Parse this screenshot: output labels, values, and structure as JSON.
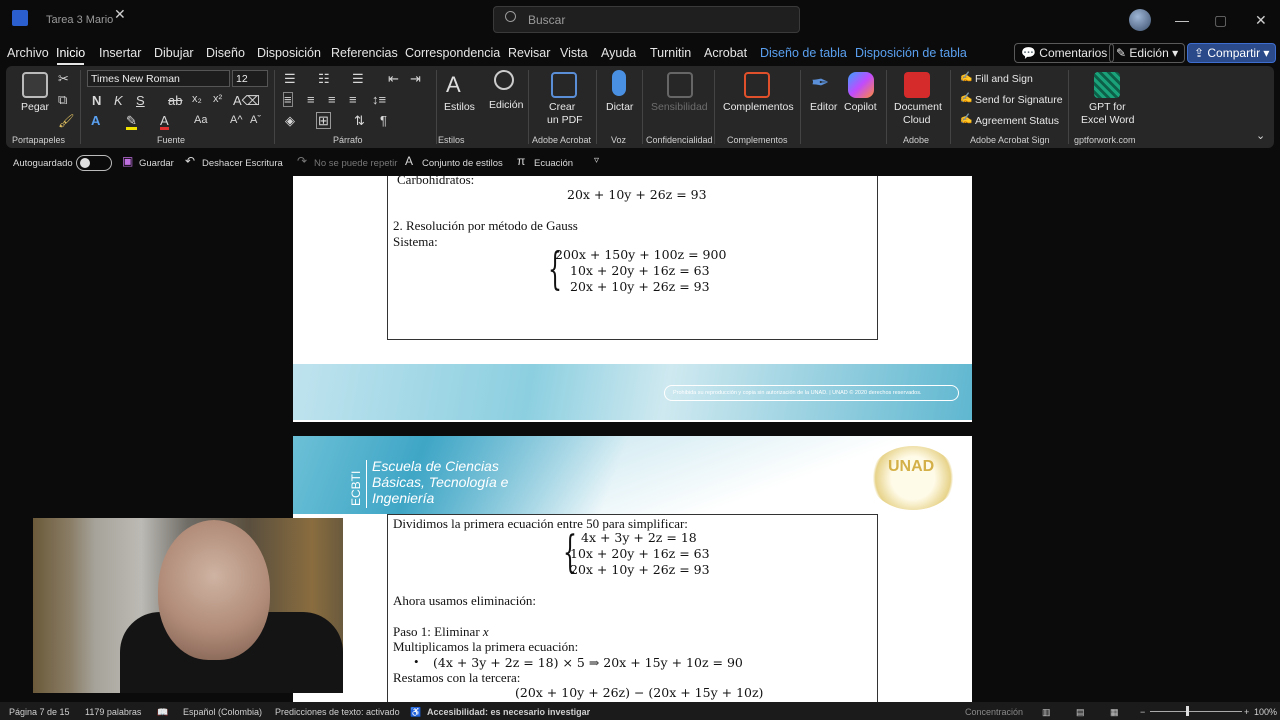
{
  "window": {
    "doc_title": "Tarea 3 Mario",
    "search_placeholder": "Buscar",
    "controls": {
      "minimize": "—",
      "maximize": "▢",
      "close": "✕"
    }
  },
  "menu": {
    "items": [
      "Archivo",
      "Inicio",
      "Insertar",
      "Dibujar",
      "Diseño",
      "Disposición",
      "Referencias",
      "Correspondencia",
      "Revisar",
      "Vista",
      "Ayuda",
      "Turnitin",
      "Acrobat"
    ],
    "contextual": [
      "Diseño de tabla",
      "Disposición de tabla"
    ],
    "comments": "Comentarios",
    "editing": "Edición",
    "share": "Compartir"
  },
  "ribbon": {
    "clipboard": {
      "paste": "Pegar",
      "label": "Portapapeles"
    },
    "font": {
      "name": "Times New Roman",
      "size": "12",
      "label": "Fuente",
      "bold": "N",
      "italic": "K",
      "underline": "S"
    },
    "paragraph": {
      "label": "Párrafo"
    },
    "styles": {
      "button": "Estilos",
      "label": "Estilos"
    },
    "editing": {
      "button": "Edición"
    },
    "acrobat": {
      "create_pdf_line1": "Crear",
      "create_pdf_line2": "un PDF",
      "label": "Adobe Acrobat"
    },
    "voice": {
      "dictate": "Dictar",
      "label": "Voz"
    },
    "sensitivity": {
      "button": "Sensibilidad",
      "label": "Confidencialidad"
    },
    "addins": {
      "button": "Complementos",
      "label": "Complementos"
    },
    "editor": "Editor",
    "copilot": "Copilot",
    "adobe": {
      "doc_cloud_line1": "Document",
      "doc_cloud_line2": "Cloud",
      "label": "Adobe"
    },
    "sign": {
      "fill": "Fill and Sign",
      "send": "Send for Signature",
      "status": "Agreement Status",
      "label": "Adobe Acrobat Sign"
    },
    "gpt": {
      "line1": "GPT for",
      "line2": "Excel Word",
      "label": "gptforwork.com"
    }
  },
  "qat": {
    "autosave": "Autoguardado",
    "save": "Guardar",
    "undo": "Deshacer Escritura",
    "redo": "No se puede repetir",
    "styles_set": "Conjunto de estilos",
    "equation": "Ecuación"
  },
  "page1": {
    "cut_line": "Carbohidratos:",
    "eq_carb": "20x + 10y + 26z = 93",
    "heading": "2. Resolución por método de Gauss",
    "system_label": "Sistema:",
    "system": [
      "200x + 150y + 100z = 900",
      "10x + 20y + 16z = 63",
      "20x + 10y + 26z = 93"
    ],
    "footer_note": "Prohibida su reproducción y copia sin autorización de la UNAD.  |  UNAD © 2020 derechos reservados."
  },
  "page2": {
    "header_side": "ECBTI",
    "school_lines": [
      "Escuela de Ciencias",
      "Básicas, Tecnología e",
      "Ingeniería"
    ],
    "logo_text": "UNAD",
    "intro": "Dividimos la primera ecuación entre 50 para simplificar:",
    "system": [
      "4x + 3y + 2z = 18",
      "10x + 20y + 16z = 63",
      "20x + 10y + 26z = 93"
    ],
    "elimination": "Ahora usamos eliminación:",
    "step1_a": "Paso 1: Eliminar ",
    "step1_var": "x",
    "multiply": "Multiplicamos la primera ecuación:",
    "bullet_eq": "(4x + 3y + 2z = 18) × 5 ⇒ 20x + 15y + 10z = 90",
    "subtract": "Restamos con la tercera:",
    "subtract_eq": "(20x + 10y + 26z) − (20x + 15y + 10z)"
  },
  "status": {
    "page": "Página 7 de 15",
    "words": "1179 palabras",
    "language": "Español (Colombia)",
    "predictions": "Predicciones de texto: activado",
    "accessibility": "Accesibilidad: es necesario investigar",
    "focus": "Concentración",
    "zoom": "100%"
  }
}
